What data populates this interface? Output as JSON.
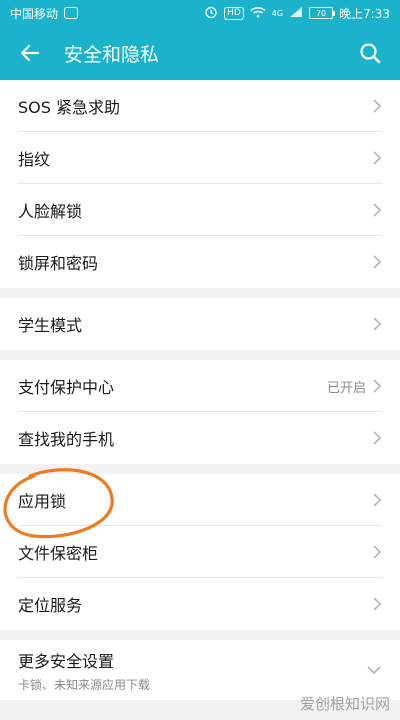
{
  "status": {
    "carrier": "中国移动",
    "time": "晚上7:33",
    "hd": "HD",
    "network": "4G",
    "battery": "70"
  },
  "header": {
    "title": "安全和隐私"
  },
  "groups": [
    {
      "items": [
        {
          "label": "SOS 紧急求助"
        },
        {
          "label": "指纹"
        },
        {
          "label": "人脸解锁"
        },
        {
          "label": "锁屏和密码"
        }
      ]
    },
    {
      "items": [
        {
          "label": "学生模式"
        }
      ]
    },
    {
      "items": [
        {
          "label": "支付保护中心",
          "value": "已开启"
        },
        {
          "label": "查找我的手机"
        }
      ]
    },
    {
      "items": [
        {
          "label": "应用锁"
        },
        {
          "label": "文件保密柜"
        },
        {
          "label": "定位服务"
        }
      ]
    },
    {
      "items": [
        {
          "label": "更多安全设置",
          "sub": "卡锁、未知来源应用下载"
        }
      ]
    }
  ],
  "watermark": "爱创根知识网",
  "colors": {
    "accent": "#1bb3cc",
    "annotation": "#f07a1e"
  }
}
